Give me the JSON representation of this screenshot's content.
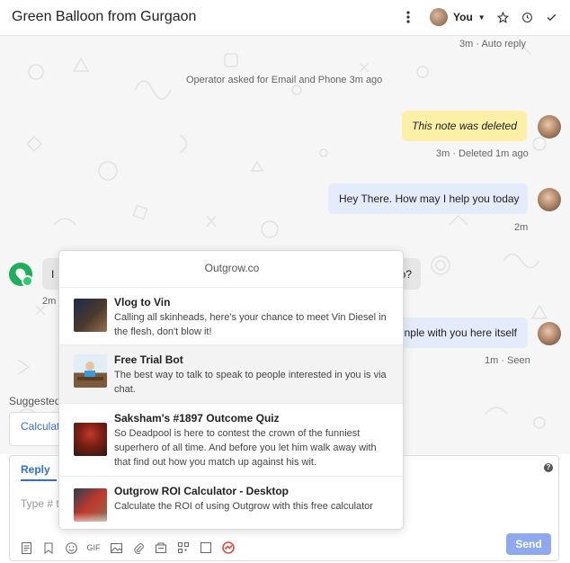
{
  "header": {
    "title": "Green Balloon from Gurgaon",
    "assignee": "You"
  },
  "chat": {
    "top_meta": "3m · Auto reply",
    "operator_event": "Operator asked for Email and Phone 3m ago",
    "deleted_note": "This note was deleted",
    "deleted_meta": "3m · Deleted 1m ago",
    "operator_message": "Hey There. How may I help you today",
    "operator_meta": "2m",
    "visitor_partial_left": "I",
    "visitor_partial_right": "o?",
    "visitor_meta": "2m",
    "operator_message2_partial": "nple with you here itself",
    "operator_meta2": "1m · Seen"
  },
  "suggested": {
    "label": "Suggested",
    "item": "Calculat"
  },
  "composer": {
    "tab": "Reply",
    "help": "?",
    "placeholder_partial": "Type # t",
    "send_label": "Send",
    "gif_label": "GIF"
  },
  "popup": {
    "title": "Outgrow.co",
    "items": [
      {
        "title": "Vlog to Vin",
        "description": "Calling all skinheads, here's your chance to meet Vin Diesel in the flesh, don't blow it!"
      },
      {
        "title": "Free Trial Bot",
        "description": "The best way to talk to speak to people interested in you is via chat."
      },
      {
        "title": "Saksham's #1897 Outcome Quiz",
        "description": "So Deadpool is here to contest the crown of the funniest superhero of all time. And before you let him walk away with that find out how you match up against his wit."
      },
      {
        "title": "Outgrow ROI Calculator - Desktop",
        "description": "Calculate the ROI of using Outgrow with this free calculator"
      }
    ]
  },
  "colors": {
    "accent": "#2f6fde",
    "note_bg": "#fbf0a5",
    "operator_bubble": "#e4ebfb",
    "visitor_bubble": "#e6e6e6",
    "send_button": "#8ea9ef",
    "outgrow_icon": "#e74c3c"
  }
}
